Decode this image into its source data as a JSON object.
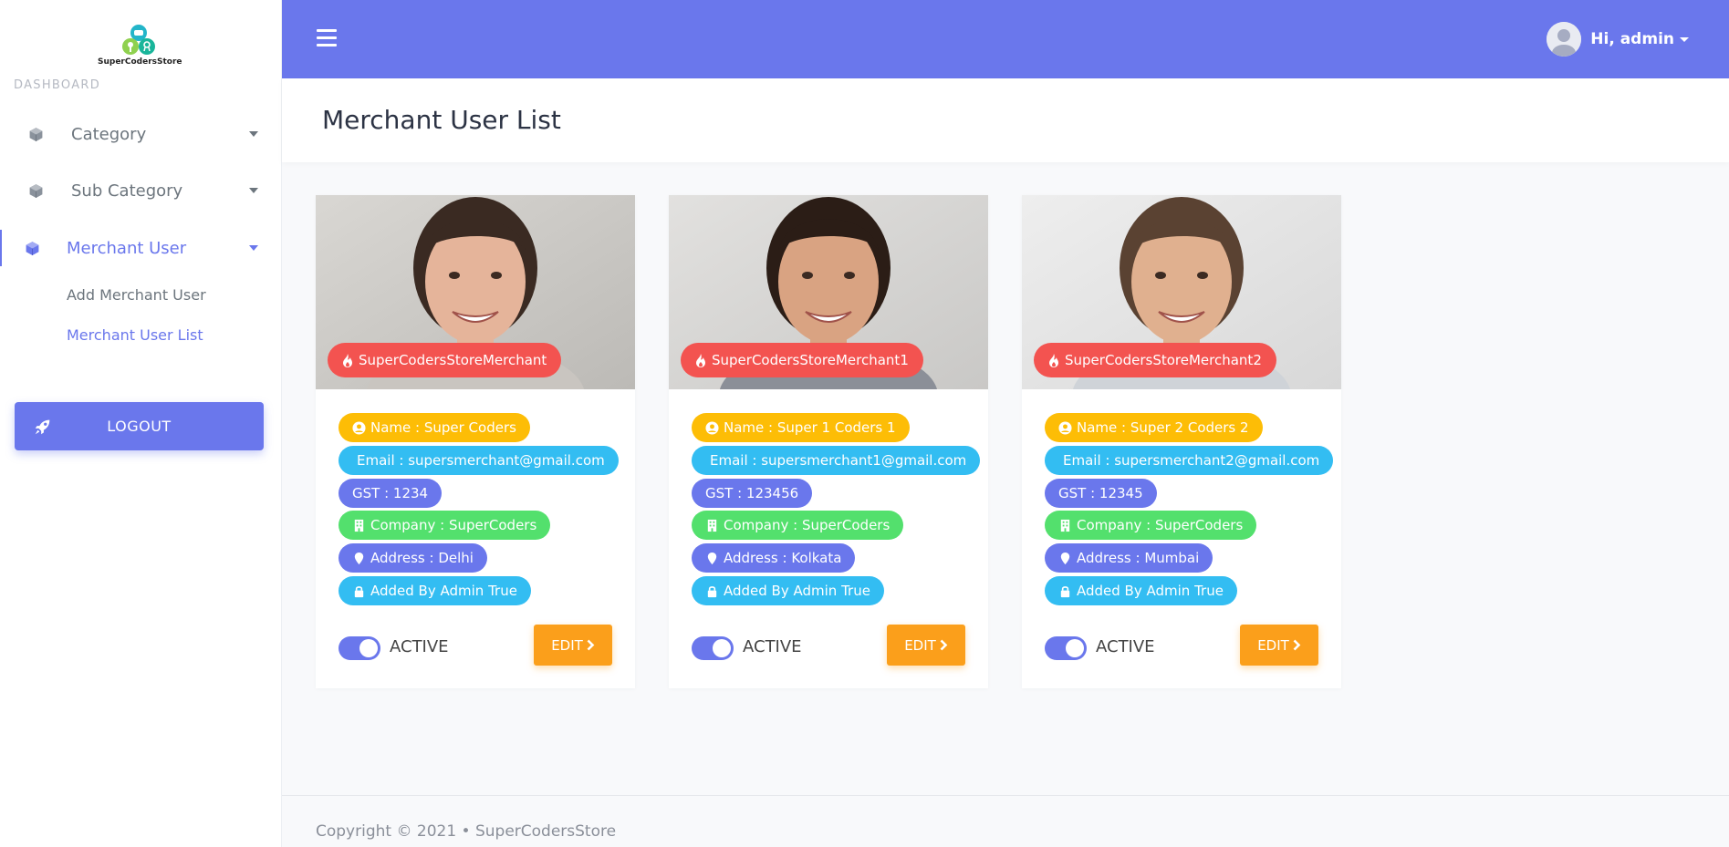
{
  "brand": {
    "name": "SuperCodersStore"
  },
  "sidebar": {
    "section_label": "DASHBOARD",
    "items": [
      {
        "label": "Category",
        "icon": "cube-icon"
      },
      {
        "label": "Sub Category",
        "icon": "cube-icon"
      },
      {
        "label": "Merchant User",
        "icon": "cube-icon",
        "active": true
      }
    ],
    "subitems": [
      {
        "label": "Add Merchant User"
      },
      {
        "label": "Merchant User List",
        "active": true
      }
    ],
    "logout_label": "LOGOUT"
  },
  "topbar": {
    "greeting": "Hi, admin"
  },
  "page": {
    "title": "Merchant User List"
  },
  "cards": [
    {
      "store": "SuperCodersStoreMerchant",
      "name": "Name : Super Coders",
      "email": "Email : supersmerchant@gmail.com",
      "gst": "GST : 1234",
      "company": "Company : SuperCoders",
      "address": "Address : Delhi",
      "added_by": "Added By Admin True",
      "status": "ACTIVE",
      "edit": "EDIT"
    },
    {
      "store": "SuperCodersStoreMerchant1",
      "name": "Name : Super 1 Coders 1",
      "email": "Email : supersmerchant1@gmail.com",
      "gst": "GST : 123456",
      "company": "Company : SuperCoders",
      "address": "Address : Kolkata",
      "added_by": "Added By Admin True",
      "status": "ACTIVE",
      "edit": "EDIT"
    },
    {
      "store": "SuperCodersStoreMerchant2",
      "name": "Name : Super 2 Coders 2",
      "email": "Email : supersmerchant2@gmail.com",
      "gst": "GST : 12345",
      "company": "Company : SuperCoders",
      "address": "Address : Mumbai",
      "added_by": "Added By Admin True",
      "status": "ACTIVE",
      "edit": "EDIT"
    }
  ],
  "footer": {
    "text": "Copyright © 2021  •  SuperCodersStore"
  },
  "colors": {
    "primary": "#6a77ec",
    "badge_red": "#f35350",
    "pill_yellow": "#fdbd06",
    "pill_cyan": "#33bdf2",
    "pill_green": "#53e06d",
    "edit_orange": "#fb9f1b"
  }
}
